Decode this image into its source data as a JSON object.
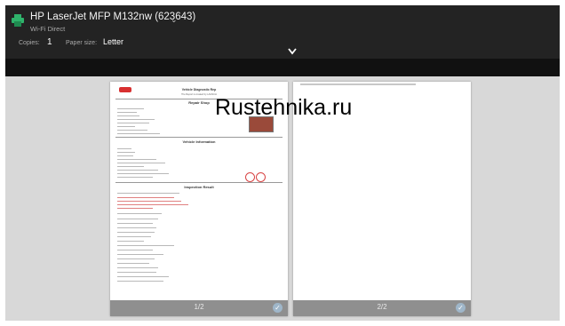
{
  "printer": {
    "name": "HP LaserJet MFP M132nw (623643)",
    "connection": "Wi-Fi Direct",
    "icon": "printer-icon"
  },
  "settings": {
    "copies_label": "Copies:",
    "copies_value": "1",
    "paper_size_label": "Paper size:",
    "paper_size_value": "Letter"
  },
  "pages": [
    {
      "number_label": "1/2"
    },
    {
      "number_label": "2/2"
    }
  ],
  "document": {
    "title": "Vehicle Diagnostic Rep",
    "subtitle": "The Report is created by LAUNCH",
    "sections": [
      "Repair Shop",
      "Vehicle Information",
      "Inspection Result"
    ]
  },
  "watermark": "Rustehnika.ru",
  "colors": {
    "topbar": "#232323",
    "midbar": "#111111",
    "background": "#d8d8d8",
    "pagebar": "#8f8f8f",
    "logo_red": "#d83030"
  }
}
